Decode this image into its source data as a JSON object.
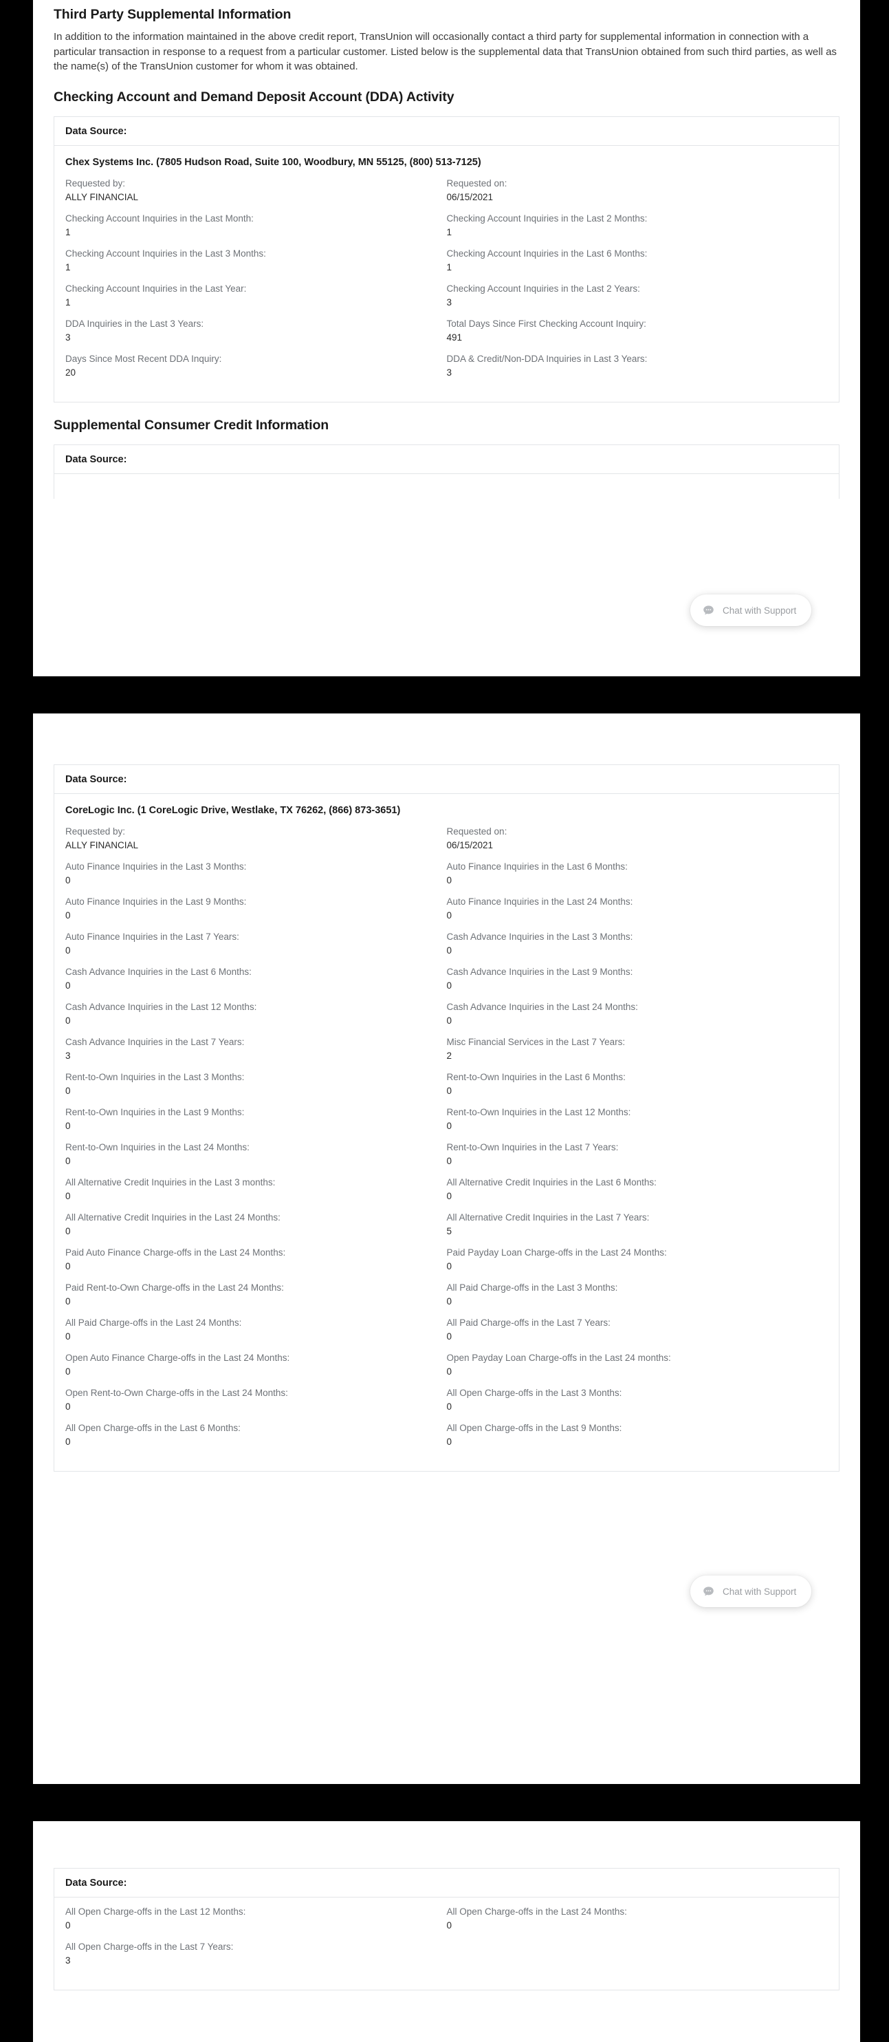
{
  "document": {
    "intro": {
      "title": "Third Party Supplemental Information",
      "paragraph": "In addition to the information maintained in the above credit report, TransUnion will occasionally contact a third party for supplemental information in connection with a particular transaction in response to a request from a particular customer. Listed below is the supplemental data that TransUnion obtained from such third parties, as well as the name(s) of the TransUnion customer for whom it was obtained."
    },
    "sections": {
      "dda_activity_title": "Checking Account and Demand Deposit Account (DDA) Activity",
      "supplemental_consumer_credit_title": "Supplemental Consumer Credit Information"
    },
    "data_source_label": "Data Source:",
    "chex": {
      "vendor": "Chex Systems Inc. (7805 Hudson Road, Suite 100, Woodbury, MN 55125, (800) 513-7125)",
      "fields": [
        {
          "label": "Requested by:",
          "value": "ALLY FINANCIAL"
        },
        {
          "label": "Requested on:",
          "value": "06/15/2021"
        },
        {
          "label": "Checking Account Inquiries in the Last Month:",
          "value": "1"
        },
        {
          "label": "Checking Account Inquiries in the Last 2 Months:",
          "value": "1"
        },
        {
          "label": "Checking Account Inquiries in the Last 3 Months:",
          "value": "1"
        },
        {
          "label": "Checking Account Inquiries in the Last 6 Months:",
          "value": "1"
        },
        {
          "label": "Checking Account Inquiries in the Last Year:",
          "value": "1"
        },
        {
          "label": "Checking Account Inquiries in the Last 2 Years:",
          "value": "3"
        },
        {
          "label": "DDA Inquiries in the Last 3 Years:",
          "value": "3"
        },
        {
          "label": "Total Days Since First Checking Account Inquiry:",
          "value": "491"
        },
        {
          "label": "Days Since Most Recent DDA Inquiry:",
          "value": "20"
        },
        {
          "label": "DDA & Credit/Non-DDA Inquiries in Last 3 Years:",
          "value": "3"
        }
      ]
    },
    "corelogic": {
      "vendor": "CoreLogic Inc. (1 CoreLogic Drive, Westlake, TX 76262, (866) 873-3651)",
      "fields": [
        {
          "label": "Requested by:",
          "value": "ALLY FINANCIAL"
        },
        {
          "label": "Requested on:",
          "value": "06/15/2021"
        },
        {
          "label": "Auto Finance Inquiries in the Last 3 Months:",
          "value": "0"
        },
        {
          "label": "Auto Finance Inquiries in the Last 6 Months:",
          "value": "0"
        },
        {
          "label": "Auto Finance Inquiries in the Last 9 Months:",
          "value": "0"
        },
        {
          "label": "Auto Finance Inquiries in the Last 24 Months:",
          "value": "0"
        },
        {
          "label": "Auto Finance Inquiries in the Last 7 Years:",
          "value": "0"
        },
        {
          "label": "Cash Advance Inquiries in the Last 3 Months:",
          "value": "0"
        },
        {
          "label": "Cash Advance Inquiries in the Last 6 Months:",
          "value": "0"
        },
        {
          "label": "Cash Advance Inquiries in the Last 9 Months:",
          "value": "0"
        },
        {
          "label": "Cash Advance Inquiries in the Last 12 Months:",
          "value": "0"
        },
        {
          "label": "Cash Advance Inquiries in the Last 24 Months:",
          "value": "0"
        },
        {
          "label": "Cash Advance Inquiries in the Last 7 Years:",
          "value": "3"
        },
        {
          "label": "Misc Financial Services in the Last 7 Years:",
          "value": "2"
        },
        {
          "label": "Rent-to-Own Inquiries in the Last 3 Months:",
          "value": "0"
        },
        {
          "label": "Rent-to-Own Inquiries in the Last 6 Months:",
          "value": "0"
        },
        {
          "label": "Rent-to-Own Inquiries in the Last 9 Months:",
          "value": "0"
        },
        {
          "label": "Rent-to-Own Inquiries in the Last 12 Months:",
          "value": "0"
        },
        {
          "label": "Rent-to-Own Inquiries in the Last 24 Months:",
          "value": "0"
        },
        {
          "label": "Rent-to-Own Inquiries in the Last 7 Years:",
          "value": "0"
        },
        {
          "label": "All Alternative Credit Inquiries in the Last 3 months:",
          "value": "0"
        },
        {
          "label": "All Alternative Credit Inquiries in the Last 6 Months:",
          "value": "0"
        },
        {
          "label": "All Alternative Credit Inquiries in the Last 24 Months:",
          "value": "0"
        },
        {
          "label": "All Alternative Credit Inquiries in the Last 7 Years:",
          "value": "5"
        },
        {
          "label": "Paid Auto Finance Charge-offs in the Last 24 Months:",
          "value": "0"
        },
        {
          "label": "Paid Payday Loan Charge-offs in the Last 24 Months:",
          "value": "0"
        },
        {
          "label": "Paid Rent-to-Own Charge-offs in the Last 24 Months:",
          "value": "0"
        },
        {
          "label": "All Paid Charge-offs in the Last 3 Months:",
          "value": "0"
        },
        {
          "label": "All Paid Charge-offs in the Last 24 Months:",
          "value": "0"
        },
        {
          "label": "All Paid Charge-offs in the Last 7 Years:",
          "value": "0"
        },
        {
          "label": "Open Auto Finance Charge-offs in the Last 24 Months:",
          "value": "0"
        },
        {
          "label": "Open Payday Loan Charge-offs in the Last 24 months:",
          "value": "0"
        },
        {
          "label": "Open Rent-to-Own Charge-offs in the Last 24 Months:",
          "value": "0"
        },
        {
          "label": "All Open Charge-offs in the Last 3 Months:",
          "value": "0"
        },
        {
          "label": "All Open Charge-offs in the Last 6 Months:",
          "value": "0"
        },
        {
          "label": "All Open Charge-offs in the Last 9 Months:",
          "value": "0"
        }
      ]
    },
    "corelogic_continued": {
      "fields": [
        {
          "label": "All Open Charge-offs in the Last 12 Months:",
          "value": "0"
        },
        {
          "label": "All Open Charge-offs in the Last 24 Months:",
          "value": "0"
        },
        {
          "label": "All Open Charge-offs in the Last 7 Years:",
          "value": "3"
        }
      ]
    }
  },
  "chat_widget": {
    "label": "Chat with Support",
    "icon": "chat-bubble-icon"
  },
  "colors": {
    "page_background": "#ffffff",
    "gutter": "#000000",
    "card_border": "#e3e5e8",
    "label_text": "#6e7277",
    "value_text": "#2b2b2b",
    "heading_text": "#1a1a1a"
  }
}
